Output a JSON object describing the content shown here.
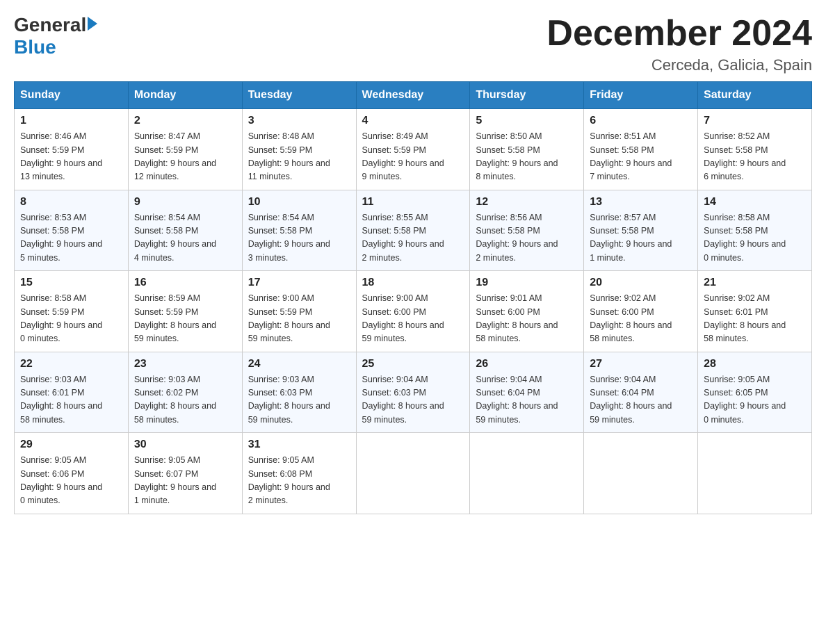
{
  "logo": {
    "general": "General",
    "blue": "Blue"
  },
  "title": "December 2024",
  "location": "Cerceda, Galicia, Spain",
  "weekdays": [
    "Sunday",
    "Monday",
    "Tuesday",
    "Wednesday",
    "Thursday",
    "Friday",
    "Saturday"
  ],
  "weeks": [
    [
      {
        "day": "1",
        "sunrise": "8:46 AM",
        "sunset": "5:59 PM",
        "daylight": "9 hours and 13 minutes."
      },
      {
        "day": "2",
        "sunrise": "8:47 AM",
        "sunset": "5:59 PM",
        "daylight": "9 hours and 12 minutes."
      },
      {
        "day": "3",
        "sunrise": "8:48 AM",
        "sunset": "5:59 PM",
        "daylight": "9 hours and 11 minutes."
      },
      {
        "day": "4",
        "sunrise": "8:49 AM",
        "sunset": "5:59 PM",
        "daylight": "9 hours and 9 minutes."
      },
      {
        "day": "5",
        "sunrise": "8:50 AM",
        "sunset": "5:58 PM",
        "daylight": "9 hours and 8 minutes."
      },
      {
        "day": "6",
        "sunrise": "8:51 AM",
        "sunset": "5:58 PM",
        "daylight": "9 hours and 7 minutes."
      },
      {
        "day": "7",
        "sunrise": "8:52 AM",
        "sunset": "5:58 PM",
        "daylight": "9 hours and 6 minutes."
      }
    ],
    [
      {
        "day": "8",
        "sunrise": "8:53 AM",
        "sunset": "5:58 PM",
        "daylight": "9 hours and 5 minutes."
      },
      {
        "day": "9",
        "sunrise": "8:54 AM",
        "sunset": "5:58 PM",
        "daylight": "9 hours and 4 minutes."
      },
      {
        "day": "10",
        "sunrise": "8:54 AM",
        "sunset": "5:58 PM",
        "daylight": "9 hours and 3 minutes."
      },
      {
        "day": "11",
        "sunrise": "8:55 AM",
        "sunset": "5:58 PM",
        "daylight": "9 hours and 2 minutes."
      },
      {
        "day": "12",
        "sunrise": "8:56 AM",
        "sunset": "5:58 PM",
        "daylight": "9 hours and 2 minutes."
      },
      {
        "day": "13",
        "sunrise": "8:57 AM",
        "sunset": "5:58 PM",
        "daylight": "9 hours and 1 minute."
      },
      {
        "day": "14",
        "sunrise": "8:58 AM",
        "sunset": "5:58 PM",
        "daylight": "9 hours and 0 minutes."
      }
    ],
    [
      {
        "day": "15",
        "sunrise": "8:58 AM",
        "sunset": "5:59 PM",
        "daylight": "9 hours and 0 minutes."
      },
      {
        "day": "16",
        "sunrise": "8:59 AM",
        "sunset": "5:59 PM",
        "daylight": "8 hours and 59 minutes."
      },
      {
        "day": "17",
        "sunrise": "9:00 AM",
        "sunset": "5:59 PM",
        "daylight": "8 hours and 59 minutes."
      },
      {
        "day": "18",
        "sunrise": "9:00 AM",
        "sunset": "6:00 PM",
        "daylight": "8 hours and 59 minutes."
      },
      {
        "day": "19",
        "sunrise": "9:01 AM",
        "sunset": "6:00 PM",
        "daylight": "8 hours and 58 minutes."
      },
      {
        "day": "20",
        "sunrise": "9:02 AM",
        "sunset": "6:00 PM",
        "daylight": "8 hours and 58 minutes."
      },
      {
        "day": "21",
        "sunrise": "9:02 AM",
        "sunset": "6:01 PM",
        "daylight": "8 hours and 58 minutes."
      }
    ],
    [
      {
        "day": "22",
        "sunrise": "9:03 AM",
        "sunset": "6:01 PM",
        "daylight": "8 hours and 58 minutes."
      },
      {
        "day": "23",
        "sunrise": "9:03 AM",
        "sunset": "6:02 PM",
        "daylight": "8 hours and 58 minutes."
      },
      {
        "day": "24",
        "sunrise": "9:03 AM",
        "sunset": "6:03 PM",
        "daylight": "8 hours and 59 minutes."
      },
      {
        "day": "25",
        "sunrise": "9:04 AM",
        "sunset": "6:03 PM",
        "daylight": "8 hours and 59 minutes."
      },
      {
        "day": "26",
        "sunrise": "9:04 AM",
        "sunset": "6:04 PM",
        "daylight": "8 hours and 59 minutes."
      },
      {
        "day": "27",
        "sunrise": "9:04 AM",
        "sunset": "6:04 PM",
        "daylight": "8 hours and 59 minutes."
      },
      {
        "day": "28",
        "sunrise": "9:05 AM",
        "sunset": "6:05 PM",
        "daylight": "9 hours and 0 minutes."
      }
    ],
    [
      {
        "day": "29",
        "sunrise": "9:05 AM",
        "sunset": "6:06 PM",
        "daylight": "9 hours and 0 minutes."
      },
      {
        "day": "30",
        "sunrise": "9:05 AM",
        "sunset": "6:07 PM",
        "daylight": "9 hours and 1 minute."
      },
      {
        "day": "31",
        "sunrise": "9:05 AM",
        "sunset": "6:08 PM",
        "daylight": "9 hours and 2 minutes."
      },
      null,
      null,
      null,
      null
    ]
  ],
  "labels": {
    "sunrise": "Sunrise:",
    "sunset": "Sunset:",
    "daylight": "Daylight:"
  }
}
